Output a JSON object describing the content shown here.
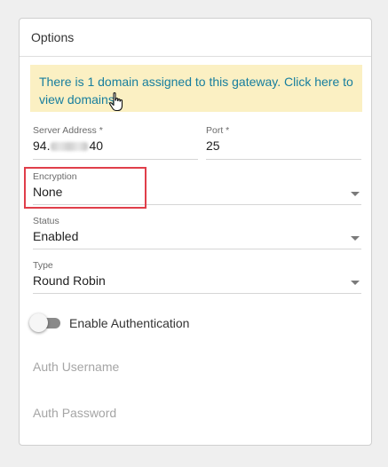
{
  "card": {
    "title": "Options"
  },
  "alert": {
    "line1": "There is 1 domain assigned to this gateway. Click here to",
    "line2": "view domains."
  },
  "server_address": {
    "label": "Server Address *",
    "value_prefix": "94.",
    "value_suffix": "40"
  },
  "port": {
    "label": "Port *",
    "value": "25"
  },
  "encryption": {
    "label": "Encryption",
    "value": "None"
  },
  "status": {
    "label": "Status",
    "value": "Enabled"
  },
  "type": {
    "label": "Type",
    "value": "Round Robin"
  },
  "auth_toggle": {
    "label": "Enable Authentication",
    "enabled": false
  },
  "auth_username": {
    "placeholder": "Auth Username"
  },
  "auth_password": {
    "placeholder": "Auth Password"
  },
  "colors": {
    "alert_bg": "#fbf0c3",
    "alert_text": "#177e9e",
    "highlight": "#e03e4a"
  }
}
